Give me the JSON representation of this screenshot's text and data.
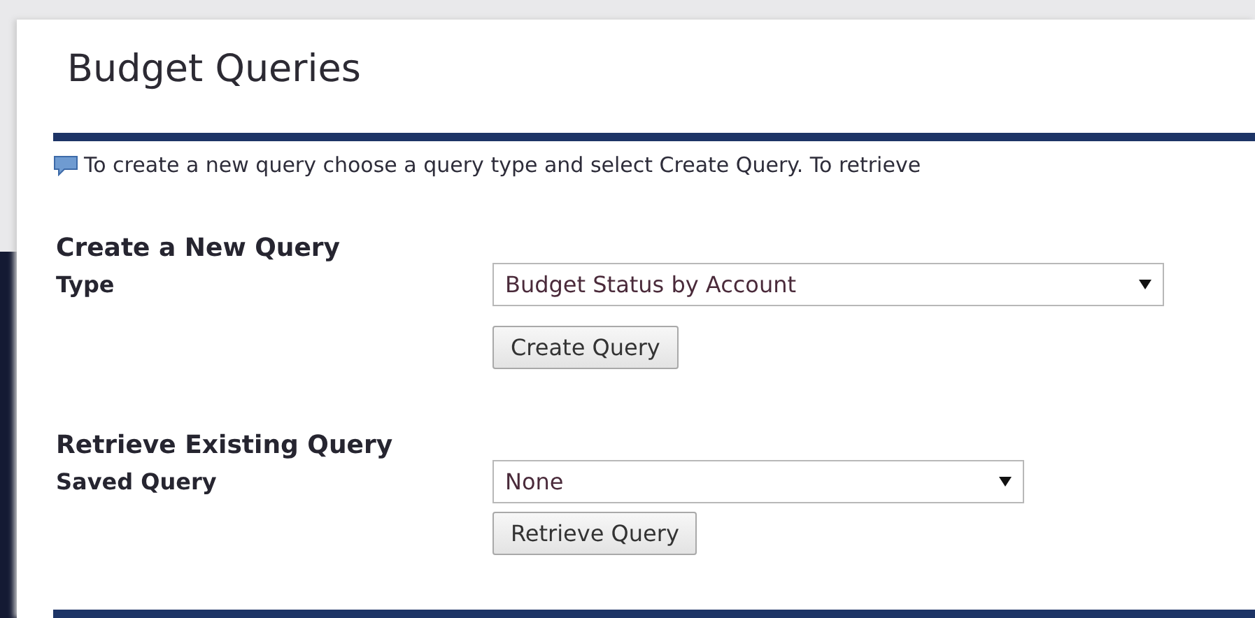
{
  "title": "Budget Queries",
  "info": "To create a new query choose a query type and select Create Query. To retrieve",
  "sections": [
    {
      "heading": "Create a New Query",
      "label": "Type",
      "value": "Budget Status by Account",
      "button": "Create Query"
    },
    {
      "heading": "Retrieve Existing Query",
      "label": "Saved Query",
      "value": "None",
      "button": "Retrieve Query"
    }
  ]
}
